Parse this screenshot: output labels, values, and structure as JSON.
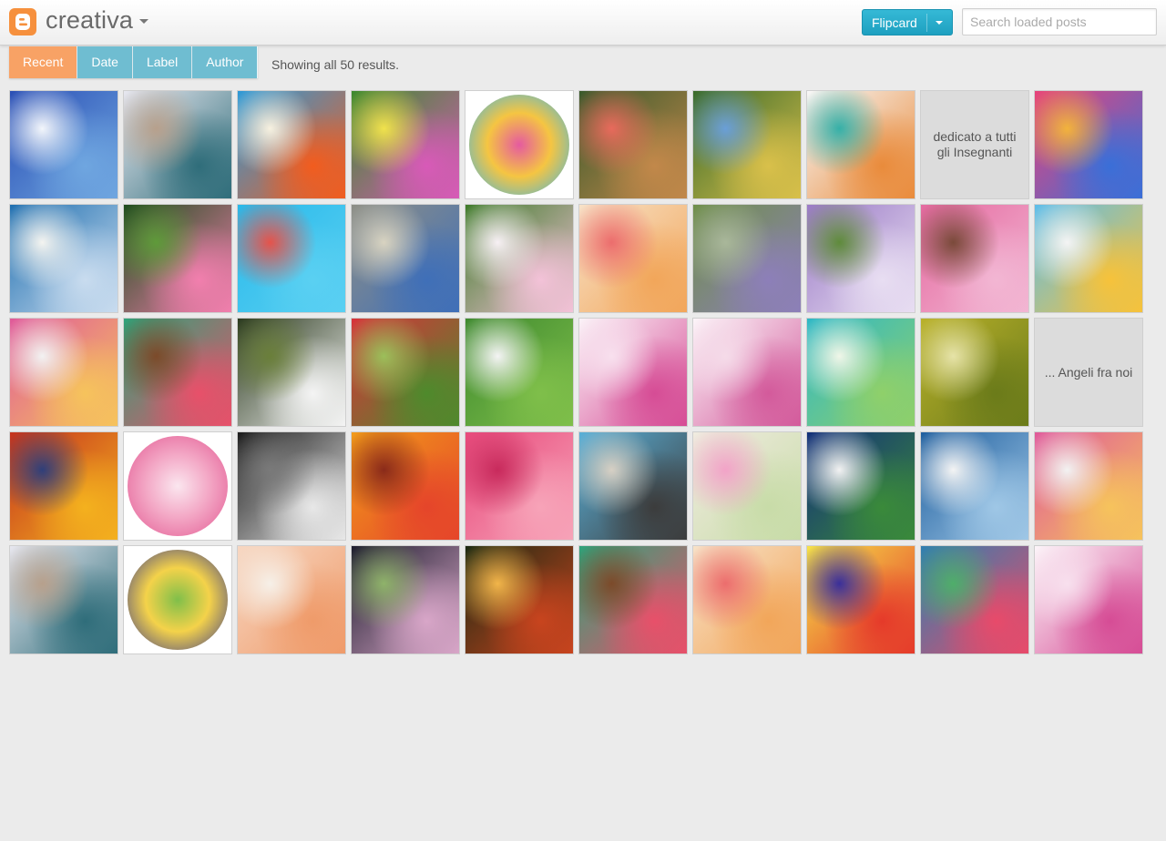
{
  "header": {
    "blog_title": "creativa",
    "view_selector": "Flipcard",
    "search_placeholder": "Search loaded posts"
  },
  "tabs": [
    {
      "label": "Recent",
      "active": true
    },
    {
      "label": "Date",
      "active": false
    },
    {
      "label": "Label",
      "active": false
    },
    {
      "label": "Author",
      "active": false
    }
  ],
  "results_text": "Showing all 50 results.",
  "colors": {
    "accent_orange": "#f8a265",
    "accent_blue": "#6fbdd1",
    "view_button": "#1ea0c0",
    "logo": "#f6903d"
  },
  "tiles": [
    {
      "kind": "image",
      "shape": "square",
      "colors": [
        "#2a4fb5",
        "#6fa6e0",
        "#f3f6fb"
      ]
    },
    {
      "kind": "image",
      "shape": "square",
      "colors": [
        "#e7e7ef",
        "#2f6d7a",
        "#b7a08c"
      ]
    },
    {
      "kind": "image",
      "shape": "square",
      "colors": [
        "#2d9ad8",
        "#f25c1e",
        "#f7f1e0"
      ]
    },
    {
      "kind": "image",
      "shape": "square",
      "colors": [
        "#3c8a2d",
        "#d85ab8",
        "#f0e24c"
      ]
    },
    {
      "kind": "image",
      "shape": "circle",
      "colors": [
        "#f5c542",
        "#3bb5e8",
        "#e55aa0"
      ]
    },
    {
      "kind": "image",
      "shape": "square",
      "colors": [
        "#3a5a2c",
        "#c2884a",
        "#e86a5c"
      ]
    },
    {
      "kind": "image",
      "shape": "square",
      "colors": [
        "#3a6b2b",
        "#d9c04a",
        "#6a9fd8"
      ]
    },
    {
      "kind": "image",
      "shape": "square",
      "colors": [
        "#f7f7f7",
        "#e98b3b",
        "#35b0a8"
      ]
    },
    {
      "kind": "text",
      "text": "dedicato a tutti gli Insegnanti"
    },
    {
      "kind": "image",
      "shape": "square",
      "colors": [
        "#e8437a",
        "#3a6fd8",
        "#f2b33c"
      ]
    },
    {
      "kind": "image",
      "shape": "square",
      "colors": [
        "#1f6fb0",
        "#c9dcef",
        "#f4f4f0"
      ]
    },
    {
      "kind": "image",
      "shape": "square",
      "colors": [
        "#1f4d1d",
        "#f27fae",
        "#5f9a3a"
      ]
    },
    {
      "kind": "image",
      "shape": "square",
      "colors": [
        "#29b9ea",
        "#5ad0f2",
        "#e5534b"
      ]
    },
    {
      "kind": "image",
      "shape": "square",
      "colors": [
        "#8e8f86",
        "#3f6fb8",
        "#d8d3c1"
      ]
    },
    {
      "kind": "image",
      "shape": "square",
      "colors": [
        "#3f7b2a",
        "#f3c2d8",
        "#f7f0f4"
      ]
    },
    {
      "kind": "image",
      "shape": "square",
      "colors": [
        "#f7e2c8",
        "#f2a65a",
        "#ec6d6d"
      ]
    },
    {
      "kind": "image",
      "shape": "square",
      "colors": [
        "#6f8f4a",
        "#8d7fb9",
        "#a9b79a"
      ]
    },
    {
      "kind": "image",
      "shape": "square",
      "colors": [
        "#9b7bc6",
        "#e8def2",
        "#5f8b3b"
      ]
    },
    {
      "kind": "image",
      "shape": "square",
      "colors": [
        "#e56aa0",
        "#f2b6d3",
        "#7a4a3a"
      ]
    },
    {
      "kind": "image",
      "shape": "square",
      "colors": [
        "#5dbdea",
        "#f7c23a",
        "#f4f4f4"
      ]
    },
    {
      "kind": "image",
      "shape": "square",
      "colors": [
        "#e05a9a",
        "#f6c35c",
        "#f2f2f2"
      ]
    },
    {
      "kind": "image",
      "shape": "square",
      "colors": [
        "#2ea37a",
        "#e8506a",
        "#7c4a2a"
      ]
    },
    {
      "kind": "image",
      "shape": "square",
      "colors": [
        "#2b3a1e",
        "#f4f4f4",
        "#6a7f3a"
      ]
    },
    {
      "kind": "image",
      "shape": "square",
      "colors": [
        "#d8323a",
        "#4e8a2c",
        "#9bbf5a"
      ]
    },
    {
      "kind": "image",
      "shape": "square",
      "colors": [
        "#3f8a2f",
        "#7fbf4a",
        "#f4f4f4"
      ]
    },
    {
      "kind": "image",
      "shape": "square",
      "colors": [
        "#fbf3f8",
        "#d64c95",
        "#f8e0ee"
      ]
    },
    {
      "kind": "image",
      "shape": "square",
      "colors": [
        "#fcf5f9",
        "#d35a9b",
        "#f5dbe9"
      ]
    },
    {
      "kind": "image",
      "shape": "square",
      "colors": [
        "#2fb8c6",
        "#8fd06a",
        "#f0f6e8"
      ]
    },
    {
      "kind": "image",
      "shape": "square",
      "colors": [
        "#b9b12a",
        "#6b7b1a",
        "#e6e3a8"
      ]
    },
    {
      "kind": "text",
      "text": "... Angeli fra noi"
    },
    {
      "kind": "image",
      "shape": "square",
      "colors": [
        "#c4321e",
        "#f4b11e",
        "#2f3f7a"
      ]
    },
    {
      "kind": "image",
      "shape": "circle",
      "colors": [
        "#f3a7c5",
        "#e25690",
        "#fbe6ef"
      ]
    },
    {
      "kind": "image",
      "shape": "square",
      "colors": [
        "#1c1c1c",
        "#e8e8e8",
        "#7a7a7a"
      ]
    },
    {
      "kind": "image",
      "shape": "square",
      "colors": [
        "#f29b1a",
        "#e5452a",
        "#8a2a1a"
      ]
    },
    {
      "kind": "image",
      "shape": "square",
      "colors": [
        "#e84a7c",
        "#f7a3b8",
        "#c82a5c"
      ]
    },
    {
      "kind": "image",
      "shape": "square",
      "colors": [
        "#5ab0d8",
        "#3c3c3c",
        "#d7d0c4"
      ]
    },
    {
      "kind": "image",
      "shape": "square",
      "colors": [
        "#f0ebe0",
        "#c8dca8",
        "#f2a3c8"
      ]
    },
    {
      "kind": "image",
      "shape": "square",
      "colors": [
        "#13307a",
        "#3a8a3a",
        "#f2f2f2"
      ]
    },
    {
      "kind": "image",
      "shape": "square",
      "colors": [
        "#1f5f9f",
        "#9fc7e6",
        "#f4f4f4"
      ]
    },
    {
      "kind": "image",
      "shape": "square",
      "colors": [
        "#e05a9a",
        "#f6c35c",
        "#f2f2f2"
      ]
    },
    {
      "kind": "image",
      "shape": "square",
      "colors": [
        "#e7e7ef",
        "#2f6d7a",
        "#b7a08c"
      ]
    },
    {
      "kind": "image",
      "shape": "circle",
      "colors": [
        "#f4d24a",
        "#3a3a8a",
        "#7fbf4a"
      ]
    },
    {
      "kind": "image",
      "shape": "square",
      "colors": [
        "#f7d7c2",
        "#ef9b6a",
        "#f6f0e8"
      ]
    },
    {
      "kind": "image",
      "shape": "square",
      "colors": [
        "#1d1d2e",
        "#d8a6c8",
        "#8fb36a"
      ]
    },
    {
      "kind": "image",
      "shape": "square",
      "colors": [
        "#1c2a12",
        "#c8441e",
        "#f2b54a"
      ]
    },
    {
      "kind": "image",
      "shape": "square",
      "colors": [
        "#2ea37a",
        "#e8506a",
        "#7c4a2a"
      ]
    },
    {
      "kind": "image",
      "shape": "square",
      "colors": [
        "#f7e2c8",
        "#f2a65a",
        "#ec6d6d"
      ]
    },
    {
      "kind": "image",
      "shape": "square",
      "colors": [
        "#f6e24a",
        "#e53a2a",
        "#3a2f9a"
      ]
    },
    {
      "kind": "image",
      "shape": "square",
      "colors": [
        "#2f7fb0",
        "#e84a6a",
        "#4fae6a"
      ]
    },
    {
      "kind": "image",
      "shape": "square",
      "colors": [
        "#fcf5f9",
        "#d64c95",
        "#f8e0ee"
      ]
    }
  ]
}
